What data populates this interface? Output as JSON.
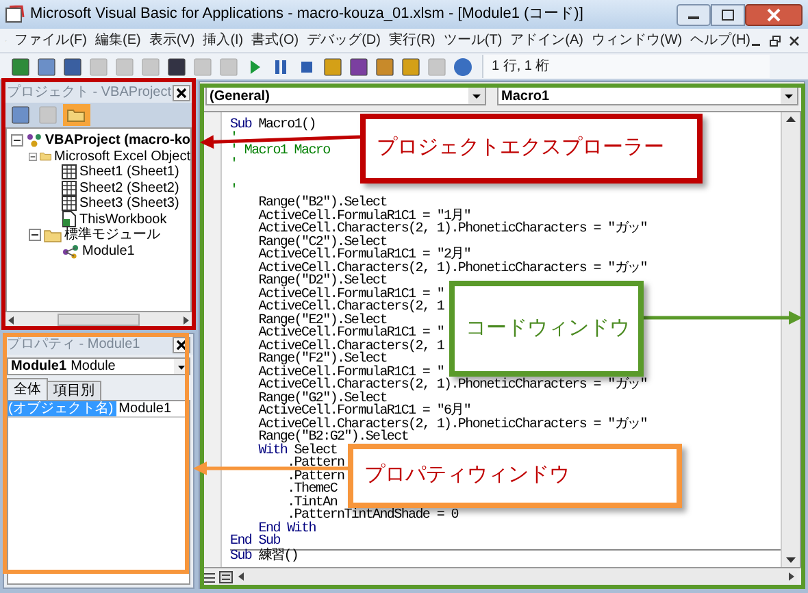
{
  "window": {
    "title": "Microsoft Visual Basic for Applications - macro-kouza_01.xlsm - [Module1 (コード)]"
  },
  "menu_bar": {
    "items": [
      "ファイル(F)",
      "編集(E)",
      "表示(V)",
      "挿入(I)",
      "書式(O)",
      "デバッグ(D)",
      "実行(R)",
      "ツール(T)",
      "アドイン(A)",
      "ウィンドウ(W)",
      "ヘルプ(H)"
    ]
  },
  "toolbar": {
    "position": "1 行, 1 桁"
  },
  "project_explorer": {
    "title": "プロジェクト - VBAProject",
    "tree": [
      {
        "label": "VBAProject (macro-ko",
        "kind": "project",
        "expanded": true,
        "children": [
          {
            "label": "Microsoft Excel Object",
            "kind": "folder",
            "expanded": true,
            "children": [
              {
                "label": "Sheet1 (Sheet1)",
                "kind": "sheet"
              },
              {
                "label": "Sheet2 (Sheet2)",
                "kind": "sheet"
              },
              {
                "label": "Sheet3 (Sheet3)",
                "kind": "sheet"
              },
              {
                "label": "ThisWorkbook",
                "kind": "workbook"
              }
            ]
          },
          {
            "label": "標準モジュール",
            "kind": "folder",
            "expanded": true,
            "children": [
              {
                "label": "Module1",
                "kind": "module"
              }
            ]
          }
        ]
      }
    ]
  },
  "properties": {
    "title": "プロパティ - Module1",
    "object_name": "Module1",
    "object_type": "Module",
    "tabs": [
      {
        "label": "全体",
        "selected": true
      },
      {
        "label": "項目別",
        "selected": false
      }
    ],
    "rows": [
      {
        "name": "(オブジェクト名)",
        "value": "Module1",
        "selected": true
      }
    ]
  },
  "code_window": {
    "object": "(General)",
    "procedure": "Macro1",
    "lines": [
      {
        "kind": "code",
        "tokens": [
          {
            "kind": "keyword",
            "text": "Sub"
          },
          {
            "kind": "text",
            "text": " Macro1()"
          }
        ]
      },
      {
        "kind": "code",
        "tokens": [
          {
            "kind": "comment",
            "text": "'"
          }
        ]
      },
      {
        "kind": "code",
        "tokens": [
          {
            "kind": "comment",
            "text": "' Macro1 Macro"
          }
        ]
      },
      {
        "kind": "code",
        "tokens": [
          {
            "kind": "comment",
            "text": "'"
          }
        ]
      },
      {
        "kind": "blank"
      },
      {
        "kind": "code",
        "tokens": [
          {
            "kind": "comment",
            "text": "'"
          }
        ]
      },
      {
        "kind": "code",
        "tokens": [
          {
            "kind": "text",
            "text": "    Range(\"B2\").Select"
          }
        ]
      },
      {
        "kind": "code",
        "tokens": [
          {
            "kind": "text",
            "text": "    ActiveCell.FormulaR1C1 = \"1月\""
          }
        ]
      },
      {
        "kind": "code",
        "tokens": [
          {
            "kind": "text",
            "text": "    ActiveCell.Characters(2, 1).PhoneticCharacters = \"ガッ\""
          }
        ]
      },
      {
        "kind": "code",
        "tokens": [
          {
            "kind": "text",
            "text": "    Range(\"C2\").Select"
          }
        ]
      },
      {
        "kind": "code",
        "tokens": [
          {
            "kind": "text",
            "text": "    ActiveCell.FormulaR1C1 = \"2月\""
          }
        ]
      },
      {
        "kind": "code",
        "tokens": [
          {
            "kind": "text",
            "text": "    ActiveCell.Characters(2, 1).PhoneticCharacters = \"ガッ\""
          }
        ]
      },
      {
        "kind": "code",
        "tokens": [
          {
            "kind": "text",
            "text": "    Range(\"D2\").Select"
          }
        ]
      },
      {
        "kind": "code",
        "tokens": [
          {
            "kind": "text",
            "text": "    ActiveCell.FormulaR1C1 = \""
          }
        ]
      },
      {
        "kind": "code",
        "tokens": [
          {
            "kind": "text",
            "text": "    ActiveCell.Characters(2, 1"
          }
        ]
      },
      {
        "kind": "code",
        "tokens": [
          {
            "kind": "text",
            "text": "    Range(\"E2\").Select"
          }
        ]
      },
      {
        "kind": "code",
        "tokens": [
          {
            "kind": "text",
            "text": "    ActiveCell.FormulaR1C1 = \""
          }
        ]
      },
      {
        "kind": "code",
        "tokens": [
          {
            "kind": "text",
            "text": "    ActiveCell.Characters(2, 1"
          }
        ]
      },
      {
        "kind": "code",
        "tokens": [
          {
            "kind": "text",
            "text": "    Range(\"F2\").Select"
          }
        ]
      },
      {
        "kind": "code",
        "tokens": [
          {
            "kind": "text",
            "text": "    ActiveCell.FormulaR1C1 = \""
          }
        ]
      },
      {
        "kind": "code",
        "tokens": [
          {
            "kind": "text",
            "text": "    ActiveCell.Characters(2, 1).PhoneticCharacters = \"ガッ\""
          }
        ]
      },
      {
        "kind": "code",
        "tokens": [
          {
            "kind": "text",
            "text": "    Range(\"G2\").Select"
          }
        ]
      },
      {
        "kind": "code",
        "tokens": [
          {
            "kind": "text",
            "text": "    ActiveCell.FormulaR1C1 = \"6月\""
          }
        ]
      },
      {
        "kind": "code",
        "tokens": [
          {
            "kind": "text",
            "text": "    ActiveCell.Characters(2, 1).PhoneticCharacters = \"ガッ\""
          }
        ]
      },
      {
        "kind": "code",
        "tokens": [
          {
            "kind": "text",
            "text": "    Range(\"B2:G2\").Select"
          }
        ]
      },
      {
        "kind": "code",
        "tokens": [
          {
            "kind": "keyword",
            "text": "    With"
          },
          {
            "kind": "text",
            "text": " Select"
          }
        ]
      },
      {
        "kind": "code",
        "tokens": [
          {
            "kind": "text",
            "text": "        .Pattern"
          }
        ]
      },
      {
        "kind": "code",
        "tokens": [
          {
            "kind": "text",
            "text": "        .Pattern"
          }
        ]
      },
      {
        "kind": "code",
        "tokens": [
          {
            "kind": "text",
            "text": "        .ThemeC"
          }
        ]
      },
      {
        "kind": "code",
        "tokens": [
          {
            "kind": "text",
            "text": "        .TintAn"
          }
        ]
      },
      {
        "kind": "code",
        "tokens": [
          {
            "kind": "text",
            "text": "        .PatternTintAndShade = 0"
          }
        ]
      },
      {
        "kind": "code",
        "tokens": [
          {
            "kind": "keyword",
            "text": "    End With"
          }
        ]
      },
      {
        "kind": "code",
        "tokens": [
          {
            "kind": "keyword",
            "text": "End Sub"
          }
        ]
      },
      {
        "kind": "code",
        "separator_above": true,
        "tokens": [
          {
            "kind": "keyword",
            "text": "Sub"
          },
          {
            "kind": "text",
            "text": " 練習()"
          }
        ]
      }
    ]
  },
  "callouts": [
    {
      "color": "#c00000",
      "label": {
        "text": "プロジェクトエクスプローラー",
        "color": "#c00000"
      }
    },
    {
      "color": "#5a9a2a",
      "label": {
        "text": "コードウィンドウ",
        "color": "#4a8a20"
      }
    },
    {
      "color": "#f7963c",
      "label": {
        "text": "プロパティウィンドウ",
        "color": "#c00000"
      }
    }
  ]
}
